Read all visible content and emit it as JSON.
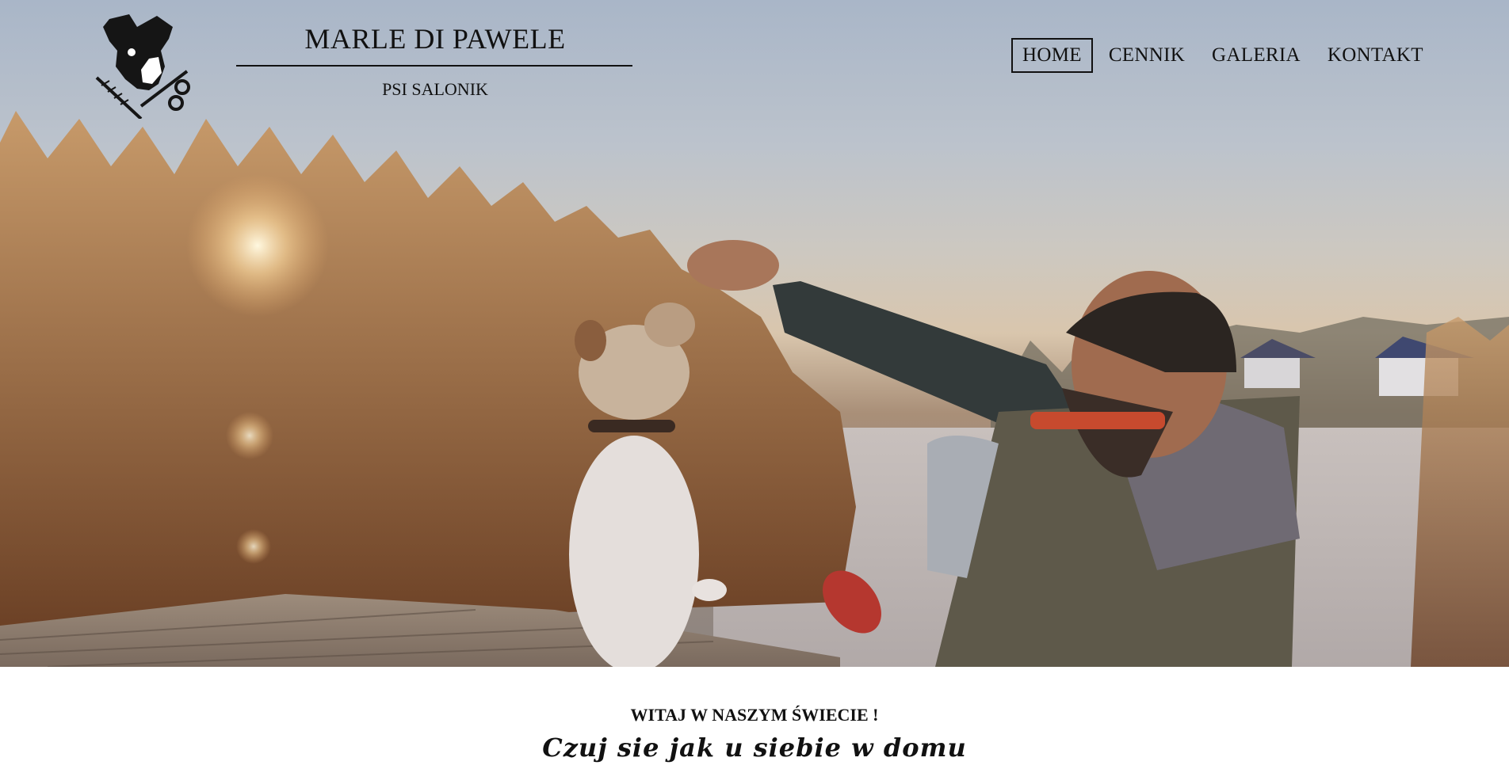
{
  "brand": {
    "title": "MARLE DI PAWELE",
    "subtitle": "PSI SALONIK",
    "logo_icon": "dog-scissors-comb-icon"
  },
  "nav": {
    "items": [
      {
        "label": "HOME",
        "active": true
      },
      {
        "label": "CENNIK",
        "active": false
      },
      {
        "label": "GALERIA",
        "active": false
      },
      {
        "label": "KONTAKT",
        "active": false
      }
    ]
  },
  "hero": {
    "image": "photo-man-feeding-dog-on-pier-at-sunset"
  },
  "content": {
    "welcome": "WITAJ W NASZYM ŚWIECIE !",
    "tagline": "Czuj sie jak u siebie w domu"
  }
}
